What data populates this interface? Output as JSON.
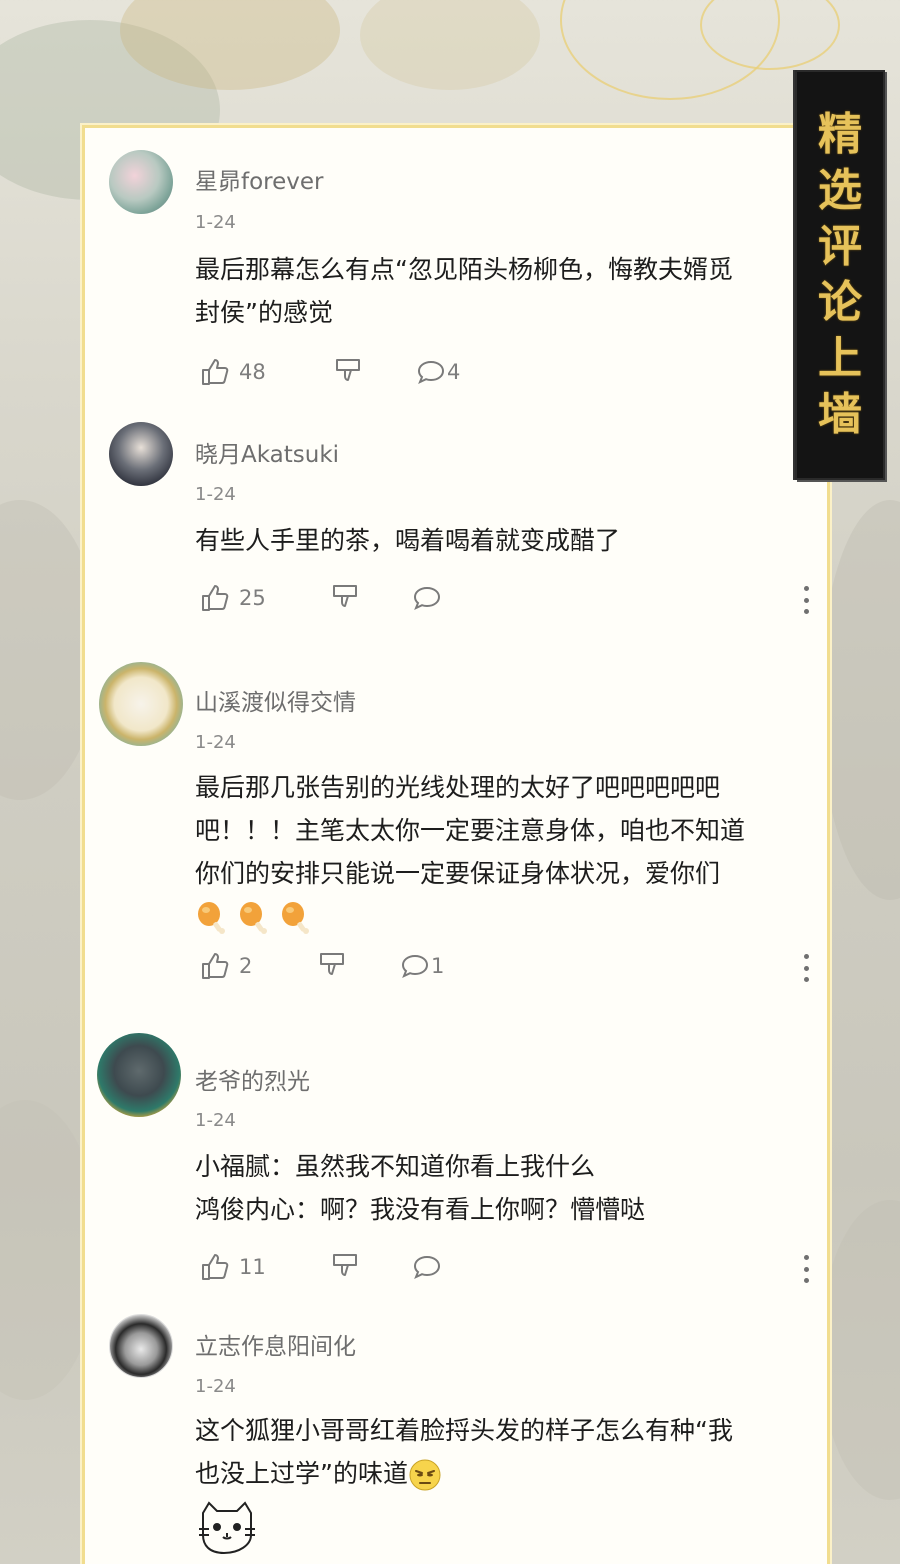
{
  "badge": {
    "chars": [
      "精",
      "选",
      "评",
      "论",
      "上",
      "墙"
    ]
  },
  "comments": [
    {
      "username": "星昴forever",
      "date": "1-24",
      "lines": [
        "最后那幕怎么有点“忽见陌头杨柳色，悔教夫婿觅",
        "封侯”的感觉"
      ],
      "likes": "48",
      "replies": "4"
    },
    {
      "username": "晓月Akatsuki",
      "date": "1-24",
      "lines": [
        "有些人手里的茶，喝着喝着就变成醋了"
      ],
      "likes": "25",
      "replies": ""
    },
    {
      "username": "山溪渡似得交情",
      "date": "1-24",
      "lines": [
        "最后那几张告别的光线处理的太好了吧吧吧吧吧",
        "吧！！！主笔太太你一定要注意身体，咱也不知道",
        "你们的安排只能说一定要保证身体状况，爱你们"
      ],
      "likes": "2",
      "replies": "1"
    },
    {
      "username": "老爷的烈光",
      "date": "1-24",
      "lines": [
        "小福腻：虽然我不知道你看上我什么",
        "鸿俊内心：啊？我没有看上你啊？懵懵哒"
      ],
      "likes": "11",
      "replies": ""
    },
    {
      "username": "立志作息阳间化",
      "date": "1-24",
      "lines": [
        "这个狐狸小哥哥红着脸捋头发的样子怎么有种“我",
        "也没上过学”的味道"
      ]
    }
  ],
  "icons": {
    "like": "thumbs-up-icon",
    "dislike": "thumbs-down-icon",
    "reply": "speech-bubble-icon",
    "more": "more-vertical-icon"
  },
  "colors": {
    "gold": "#e6c25a",
    "card_border": "#f1dd8f",
    "muted": "#7d7d7d"
  }
}
